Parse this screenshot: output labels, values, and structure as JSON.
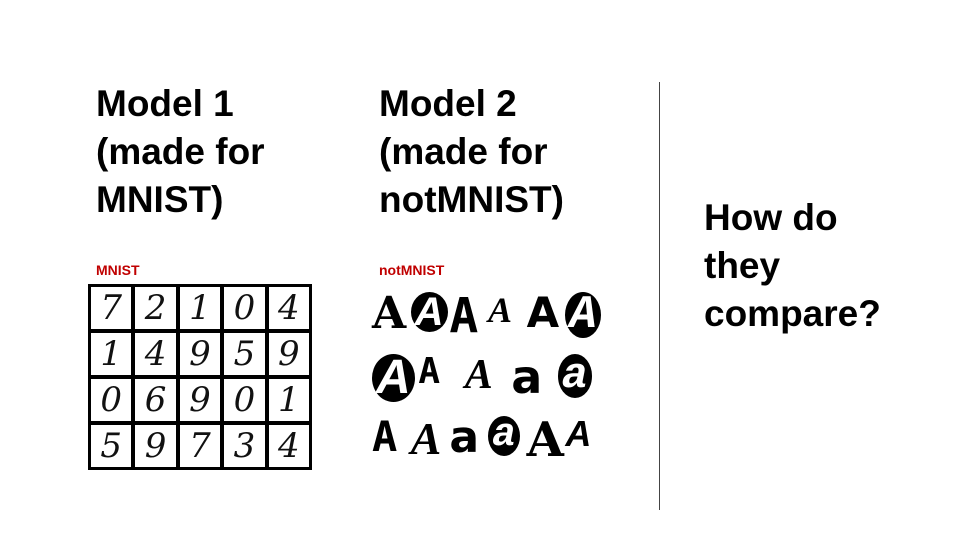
{
  "model1": {
    "lines": [
      "Model 1",
      "(made for",
      "MNIST)"
    ]
  },
  "model2": {
    "lines": [
      "Model 2",
      "(made for",
      "notMNIST)"
    ]
  },
  "mnist_caption": "MNIST",
  "notmnist_caption": "notMNIST",
  "question": {
    "lines": [
      "How do",
      "they",
      "compare?"
    ]
  },
  "colors": {
    "caption": "#c00000",
    "text": "#000000",
    "divider": "#444444"
  },
  "mnist_digits": [
    [
      "7",
      "2",
      "1",
      "0",
      "4"
    ],
    [
      "1",
      "4",
      "9",
      "5",
      "9"
    ],
    [
      "0",
      "6",
      "9",
      "0",
      "1"
    ],
    [
      "5",
      "9",
      "7",
      "3",
      "4"
    ]
  ],
  "notmnist_rows": [
    [
      "A",
      "A",
      "A",
      "A",
      "A",
      "A"
    ],
    [
      "A",
      "A",
      "A",
      "a",
      "a"
    ],
    [
      "A",
      "A",
      "a",
      "a",
      "A",
      "A"
    ]
  ]
}
